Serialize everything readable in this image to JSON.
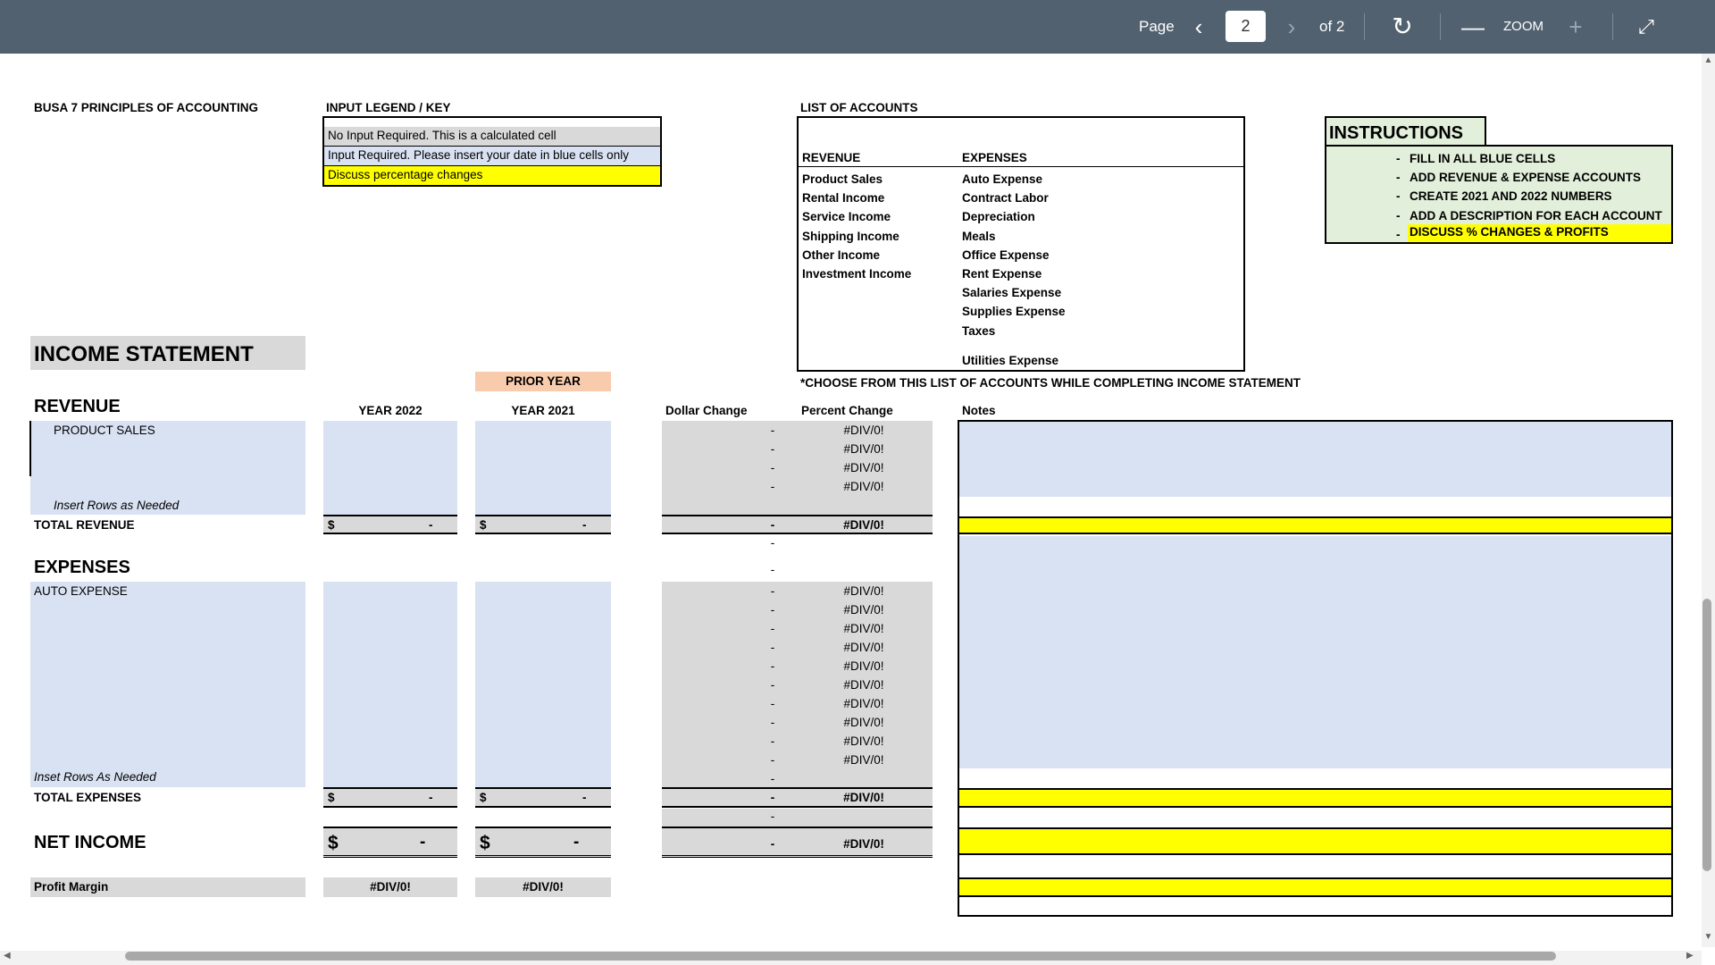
{
  "toolbar": {
    "page_label": "Page",
    "current_page": "2",
    "of_label": "of 2",
    "zoom_label": "ZOOM"
  },
  "course_title": "BUSA 7 PRINCIPLES OF ACCOUNTING",
  "legend": {
    "title": "INPUT LEGEND / KEY",
    "items": [
      "No Input Required. This is a calculated cell",
      "Input Required. Please insert your date in blue cells only",
      "Discuss percentage changes"
    ]
  },
  "accounts": {
    "title": "LIST OF ACCOUNTS",
    "revenue_header": "REVENUE",
    "expenses_header": "EXPENSES",
    "revenue": [
      "Product Sales",
      "Rental Income",
      "Service Income",
      "Shipping Income",
      "Other Income",
      "Investment Income"
    ],
    "expenses": [
      "Auto Expense",
      "Contract Labor",
      "Depreciation",
      "Meals",
      "Office Expense",
      "Rent Expense",
      "Salaries Expense",
      "Supplies Expense",
      "Taxes",
      "Utilities Expense"
    ],
    "note": "*CHOOSE FROM THIS LIST OF ACCOUNTS WHILE COMPLETING INCOME STATEMENT"
  },
  "instructions": {
    "title": "INSTRUCTIONS",
    "dash": "-",
    "items": [
      "FILL IN ALL BLUE CELLS",
      "ADD REVENUE & EXPENSE ACCOUNTS",
      "CREATE 2021 AND 2022 NUMBERS",
      "ADD A DESCRIPTION FOR EACH ACCOUNT",
      "DISCUSS % CHANGES & PROFITS"
    ]
  },
  "statement": {
    "title": "INCOME STATEMENT",
    "prior_year": "PRIOR YEAR",
    "col_2022": "YEAR 2022",
    "col_2021": "YEAR 2021",
    "col_dollar": "Dollar Change",
    "col_percent": "Percent Change",
    "col_notes": "Notes",
    "revenue_header": "REVENUE",
    "revenue_item": "PRODUCT SALES",
    "revenue_insert": "Insert Rows as Needed",
    "total_revenue": "TOTAL REVENUE",
    "expenses_header": "EXPENSES",
    "expense_item": "AUTO EXPENSE",
    "expense_insert": "Inset Rows As Needed",
    "total_expenses": "TOTAL EXPENSES",
    "net_income": "NET INCOME",
    "profit_margin": "Profit Margin",
    "dollar_sign": "$",
    "dash": "-",
    "div0": "#DIV/0!"
  }
}
